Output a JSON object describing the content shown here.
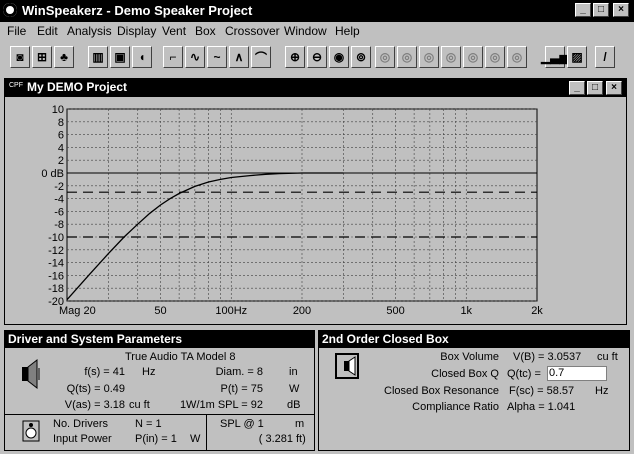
{
  "app": {
    "title": "WinSpeakerz - Demo Speaker Project"
  },
  "menu": [
    "File",
    "Edit",
    "Analysis",
    "Display",
    "Vent",
    "Box",
    "Crossover",
    "Window",
    "Help"
  ],
  "toolbar_icons": [
    "driver-icon",
    "speaker-box-icon",
    "car-icon",
    "tweeter-icon",
    "cabinet-icon",
    "vent-icon",
    "response-flat-icon",
    "response-wave-icon",
    "response-dip-icon",
    "response-peak-icon",
    "response-rolloff-icon",
    "zoom-in-icon",
    "zoom-out-icon",
    "zoom-active-icon",
    "zoom-reset-icon",
    "zoom-disabled-icon",
    "zoom-disabled-icon",
    "zoom-disabled-icon",
    "zoom-disabled-icon",
    "zoom-disabled-icon",
    "zoom-disabled-icon",
    "zoom-disabled-icon",
    "bar-graph-icon",
    "save-icon",
    "line-icon"
  ],
  "project": {
    "title": "My DEMO Project",
    "corner_label": "CPF"
  },
  "chart_data": {
    "type": "line",
    "xscale": "log",
    "xlim": [
      20,
      2000
    ],
    "x_ticks": [
      {
        "v": 20,
        "label": "Mag 20"
      },
      {
        "v": 50,
        "label": "50"
      },
      {
        "v": 100,
        "label": "100Hz"
      },
      {
        "v": 200,
        "label": "200"
      },
      {
        "v": 500,
        "label": "500"
      },
      {
        "v": 1000,
        "label": "1k"
      },
      {
        "v": 2000,
        "label": "2k"
      }
    ],
    "ylim": [
      -20,
      10
    ],
    "y_ticks": [
      {
        "v": 10,
        "label": "10"
      },
      {
        "v": 8,
        "label": "8"
      },
      {
        "v": 6,
        "label": "6"
      },
      {
        "v": 4,
        "label": "4"
      },
      {
        "v": 2,
        "label": "2"
      },
      {
        "v": 0,
        "label": "0 dB"
      },
      {
        "v": -2,
        "label": "-2"
      },
      {
        "v": -4,
        "label": "-4"
      },
      {
        "v": -6,
        "label": "-6"
      },
      {
        "v": -8,
        "label": "-8"
      },
      {
        "v": -10,
        "label": "-10"
      },
      {
        "v": -12,
        "label": "-12"
      },
      {
        "v": -14,
        "label": "-14"
      },
      {
        "v": -16,
        "label": "-16"
      },
      {
        "v": -18,
        "label": "-18"
      },
      {
        "v": -20,
        "label": "-20"
      }
    ],
    "grid": true,
    "reference_lines": [
      0,
      -3,
      -10
    ],
    "series": [
      {
        "x": [
          20,
          25,
          30,
          35,
          40,
          45,
          50,
          55,
          60,
          70,
          80,
          90,
          100,
          120,
          140,
          160,
          200,
          250,
          300
        ],
        "y": [
          -19.8,
          -15.8,
          -12.6,
          -10.0,
          -8.0,
          -6.3,
          -5.0,
          -4.0,
          -3.2,
          -2.1,
          -1.4,
          -1.0,
          -0.7,
          -0.4,
          -0.2,
          -0.1,
          0,
          0,
          0
        ]
      }
    ]
  },
  "driver_panel": {
    "title": "Driver and System Parameters",
    "model": "True Audio TA Model 8",
    "fs_label": "f(s) = 41",
    "fs_unit": "Hz",
    "qts_label": "Q(ts) = 0.49",
    "vas_label": "V(as) = 3.18",
    "vas_unit": "cu ft",
    "diam_label": "Diam. = 8",
    "diam_unit": "in",
    "pt_label": "P(t) = 75",
    "pt_unit": "W",
    "spl_label": "1W/1m SPL = 92",
    "spl_unit": "dB",
    "ndrivers_name": "No. Drivers",
    "ndrivers_val": "N = 1",
    "power_name": "Input Power",
    "power_val": "P(in) = 1",
    "power_unit": "W",
    "splat_label": "SPL @ 1",
    "splat_unit": "m",
    "dist_val": "( 3.281",
    "dist_unit": "ft)"
  },
  "box_panel": {
    "title": "2nd Order Closed Box",
    "vol_name": "Box Volume",
    "vol_val": "V(B) = 3.0537",
    "vol_unit": "cu ft",
    "q_name": "Closed Box Q",
    "q_label": "Q(tc) =",
    "q_input": "0.7",
    "res_name": "Closed Box Resonance",
    "res_val": "F(sc) = 58.57",
    "res_unit": "Hz",
    "alpha_name": "Compliance Ratio",
    "alpha_val": "Alpha = 1.041"
  }
}
